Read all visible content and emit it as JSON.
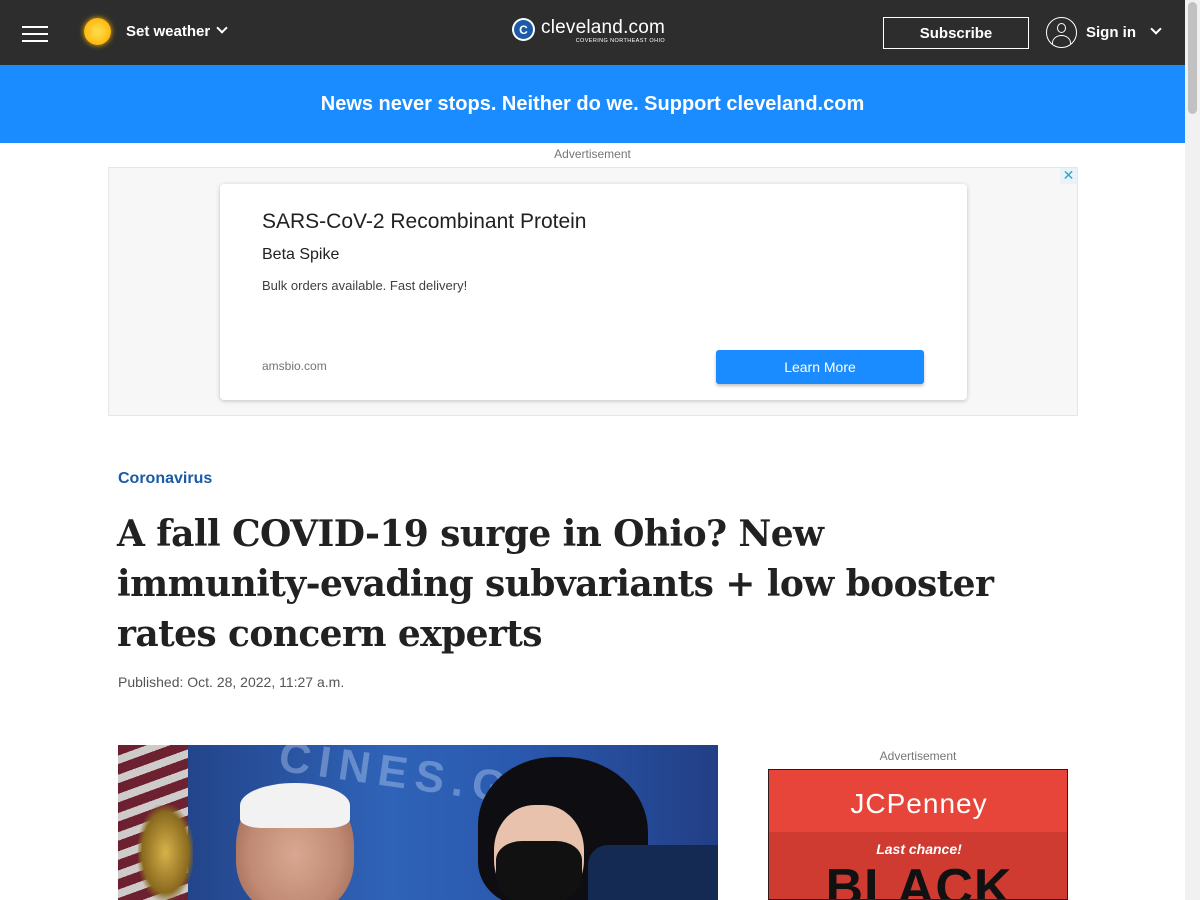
{
  "header": {
    "menu_icon": "hamburger-menu-icon",
    "weather": {
      "icon": "sun-icon",
      "label": "Set weather"
    },
    "logo": {
      "mark": "C",
      "wordmark": "cleveland.com",
      "tagline": "COVERING NORTHEAST OHIO"
    },
    "subscribe_label": "Subscribe",
    "signin": {
      "icon": "user-icon",
      "label": "Sign in"
    }
  },
  "promo_banner": {
    "text": "News never stops. Neither do we. Support cleveland.com",
    "background": "#1a8cff"
  },
  "top_ad": {
    "label": "Advertisement",
    "close_glyph": "✕",
    "title": "SARS-CoV-2 Recombinant Protein",
    "subtitle": "Beta Spike",
    "description": "Bulk orders available. Fast delivery!",
    "domain": "amsbio.com",
    "cta": "Learn More"
  },
  "article": {
    "section": "Coronavirus",
    "headline": "A fall COVID-19 surge in Ohio? New immunity-evading subvariants + low booster rates concern experts",
    "published": "Published: Oct. 28, 2022, 11:27 a.m.",
    "photo_background_text": "CINES.GO"
  },
  "sidebar_ad": {
    "label": "Advertisement",
    "brand": "JCPenney",
    "line1": "Last chance!",
    "line2": "BLACK"
  },
  "colors": {
    "nav_background": "#2d2d2d",
    "accent_blue": "#1a8cff",
    "link_blue": "#1a5aa6",
    "jcp_red": "#e8453a"
  }
}
